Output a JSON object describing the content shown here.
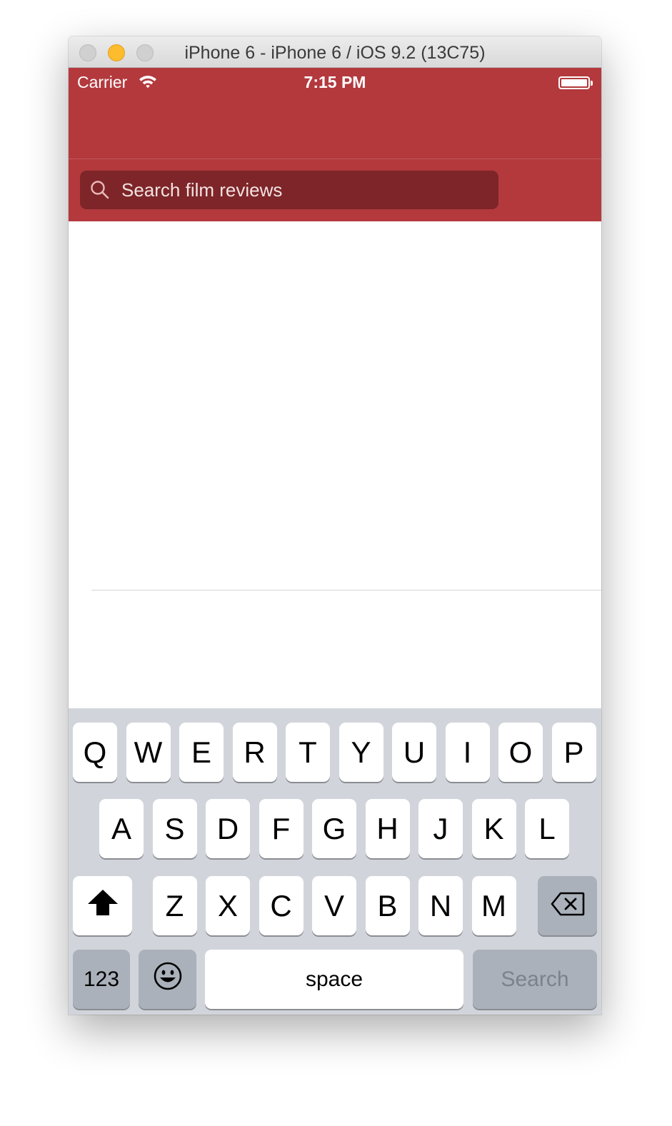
{
  "window": {
    "title": "iPhone 6 - iPhone 6 / iOS 9.2 (13C75)"
  },
  "statusbar": {
    "carrier": "Carrier",
    "time": "7:15 PM",
    "battery_level": 1.0
  },
  "search": {
    "placeholder": "Search film reviews",
    "value": ""
  },
  "keyboard": {
    "row1": [
      "Q",
      "W",
      "E",
      "R",
      "T",
      "Y",
      "U",
      "I",
      "O",
      "P"
    ],
    "row2": [
      "A",
      "S",
      "D",
      "F",
      "G",
      "H",
      "J",
      "K",
      "L"
    ],
    "row3": [
      "Z",
      "X",
      "C",
      "V",
      "B",
      "N",
      "M"
    ],
    "numbers_label": "123",
    "space_label": "space",
    "return_label": "Search",
    "shift_icon": "shift-icon",
    "delete_icon": "delete-icon",
    "emoji_icon": "emoji-icon"
  },
  "colors": {
    "nav_background": "#b3393d",
    "search_field": "#7d2528",
    "keyboard_background": "#d1d5db",
    "dark_key": "#abb1ba"
  }
}
